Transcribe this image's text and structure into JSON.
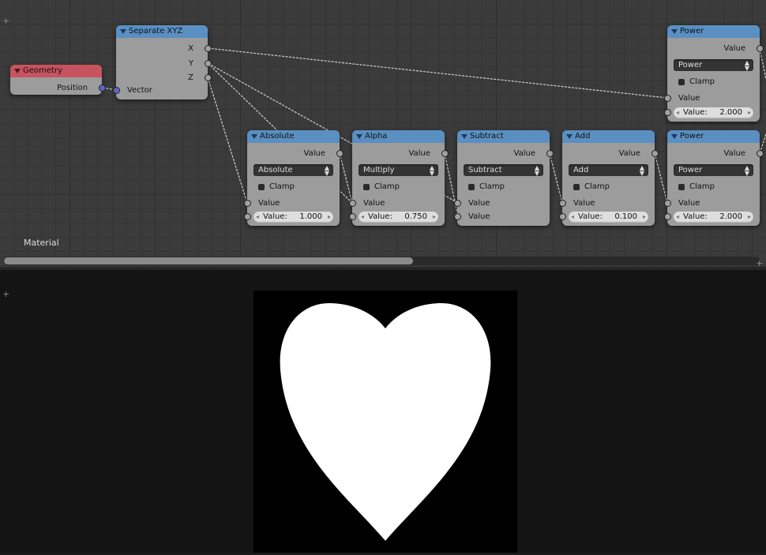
{
  "node_editor": {
    "material_label": "Material",
    "nodes": {
      "geometry": {
        "title": "Geometry",
        "outputs": [
          "Position"
        ]
      },
      "separate_xyz": {
        "title": "Separate XYZ",
        "outputs": [
          "X",
          "Y",
          "Z"
        ],
        "inputs": [
          "Vector"
        ]
      },
      "power_top": {
        "title": "Power",
        "output": "Value",
        "operation": "Power",
        "clamp": "Clamp",
        "input": "Value",
        "value_label": "Value:",
        "value": "2.000"
      },
      "absolute": {
        "title": "Absolute",
        "output": "Value",
        "operation": "Absolute",
        "clamp": "Clamp",
        "input": "Value",
        "value_label": "Value:",
        "value": "1.000"
      },
      "alpha": {
        "title": "Alpha",
        "output": "Value",
        "operation": "Multiply",
        "clamp": "Clamp",
        "input": "Value",
        "value_label": "Value:",
        "value": "0.750"
      },
      "subtract": {
        "title": "Subtract",
        "output": "Value",
        "operation": "Subtract",
        "clamp": "Clamp",
        "input1": "Value",
        "input2": "Value"
      },
      "add": {
        "title": "Add",
        "output": "Value",
        "operation": "Add",
        "clamp": "Clamp",
        "input": "Value",
        "value_label": "Value:",
        "value": "0.100"
      },
      "power_bottom": {
        "title": "Power",
        "output": "Value",
        "operation": "Power",
        "clamp": "Clamp",
        "input": "Value",
        "value_label": "Value:",
        "value": "2.000"
      }
    }
  },
  "icons": {
    "plus": "+",
    "triangle": "collapse-triangle-icon"
  },
  "colors": {
    "node_header_blue": "#5a8fc2",
    "node_header_red": "#c7535e",
    "vector_socket": "#6363c7",
    "render_background": "#000000",
    "render_shape": "#ffffff"
  },
  "preview": {
    "shape": "heart"
  }
}
